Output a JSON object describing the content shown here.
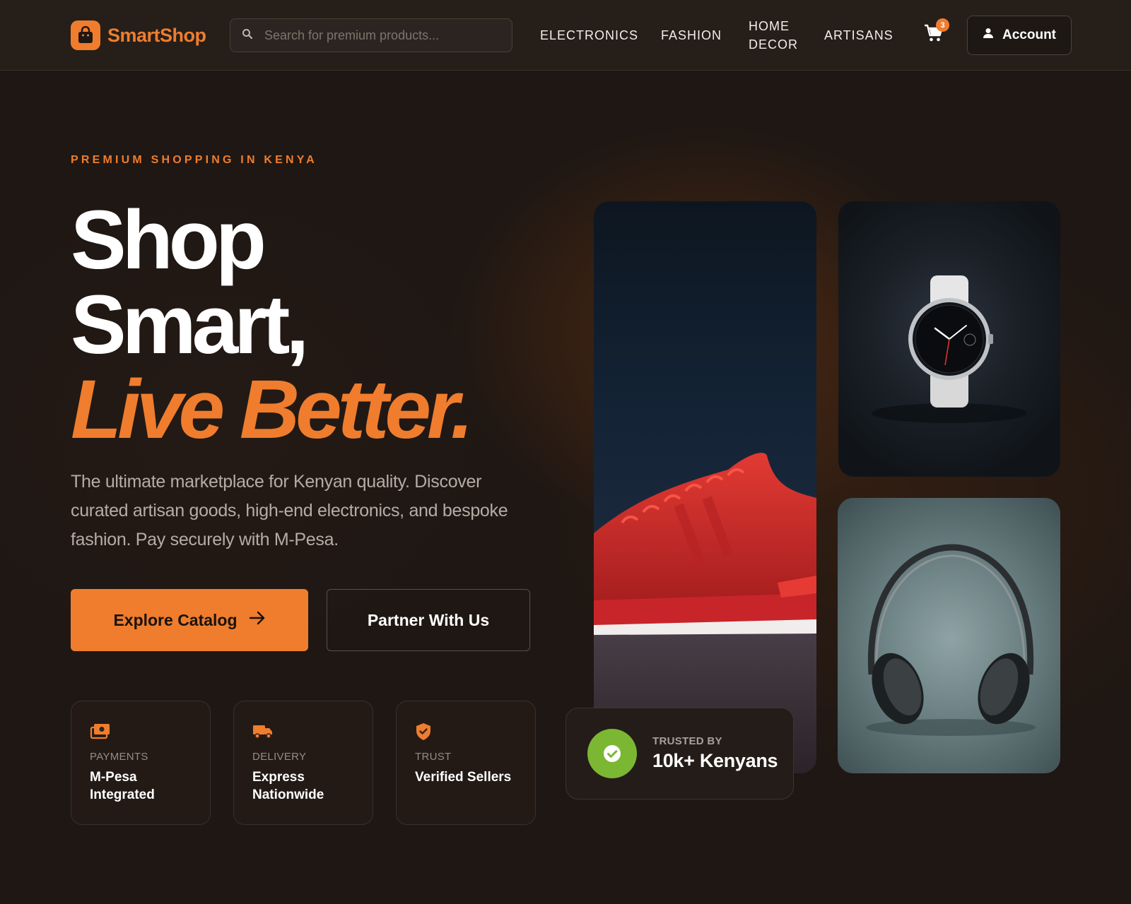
{
  "header": {
    "brand": "SmartShop",
    "search_placeholder": "Search for premium products...",
    "nav": [
      "ELECTRONICS",
      "FASHION",
      "HOME",
      "DECOR",
      "ARTISANS"
    ],
    "cart_count": "3",
    "account_label": "Account"
  },
  "hero": {
    "eyebrow": "PREMIUM SHOPPING IN KENYA",
    "headline_line1": "Shop",
    "headline_line2": "Smart,",
    "headline_accent": "Live Better.",
    "lead": "The ultimate marketplace for Kenyan quality. Discover curated artisan goods, high-end electronics, and bespoke fashion. Pay securely with M-Pesa.",
    "primary_cta": "Explore Catalog",
    "secondary_cta": "Partner With Us"
  },
  "features": [
    {
      "label": "PAYMENTS",
      "value": "M-Pesa Integrated",
      "icon": "money-icon"
    },
    {
      "label": "DELIVERY",
      "value": "Express Nationwide",
      "icon": "truck-icon"
    },
    {
      "label": "TRUST",
      "value": "Verified Sellers",
      "icon": "shield-check-icon"
    }
  ],
  "trust_badge": {
    "label": "TRUSTED BY",
    "value": "10k+ Kenyans"
  },
  "colors": {
    "accent": "#ef7d2d",
    "background": "#1f1713",
    "success": "#7cb733"
  }
}
